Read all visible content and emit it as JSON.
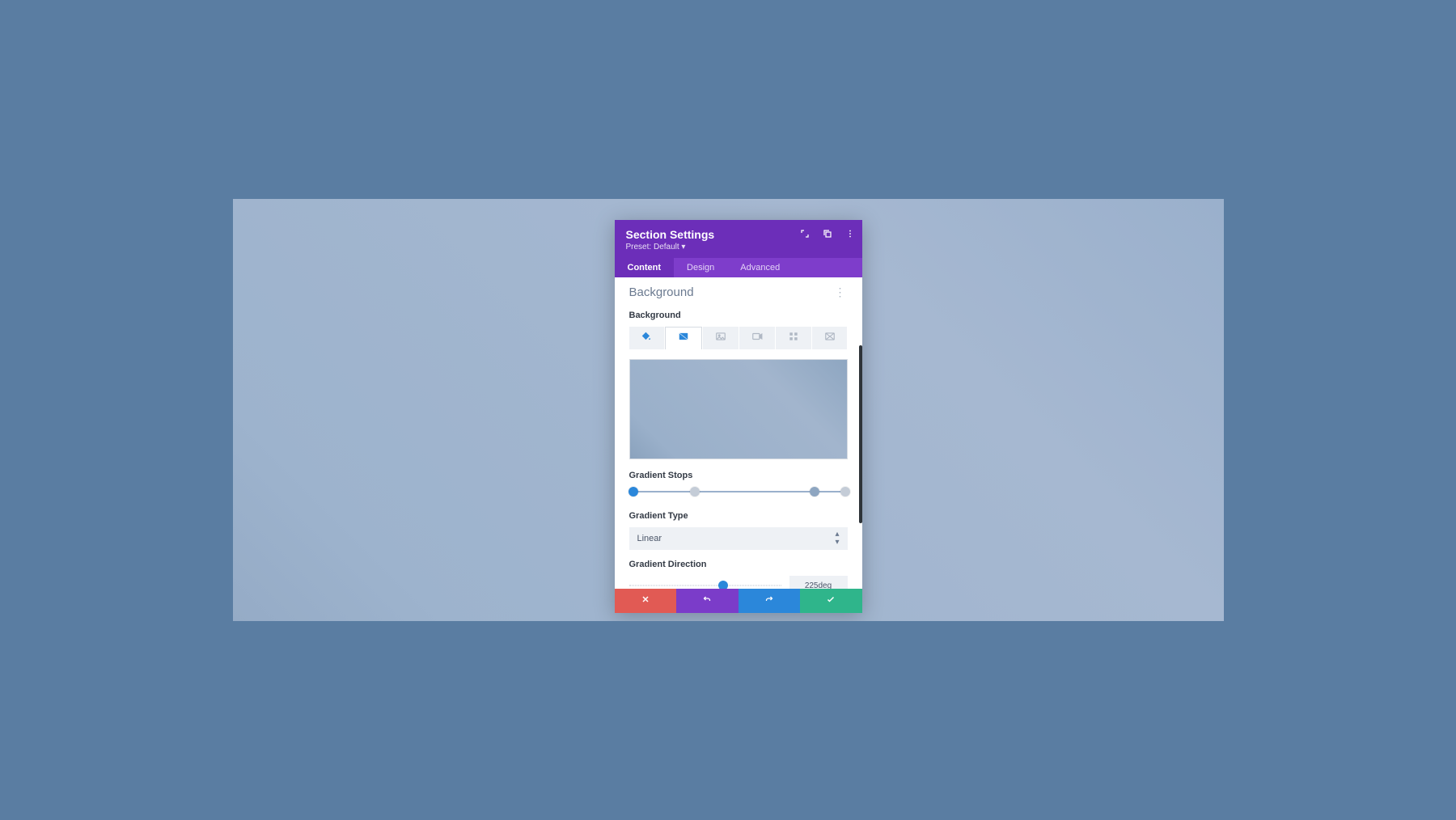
{
  "header": {
    "title": "Section Settings",
    "preset_prefix": "Preset: ",
    "preset_value": "Default ▾"
  },
  "tabs": [
    {
      "id": "content",
      "label": "Content",
      "active": true
    },
    {
      "id": "design",
      "label": "Design",
      "active": false
    },
    {
      "id": "advanced",
      "label": "Advanced",
      "active": false
    }
  ],
  "section": {
    "title": "Background"
  },
  "background": {
    "label": "Background",
    "type_tabs": [
      {
        "id": "color",
        "icon": "paint-bucket-icon",
        "active": false
      },
      {
        "id": "gradient",
        "icon": "gradient-icon",
        "active": true
      },
      {
        "id": "image",
        "icon": "image-icon",
        "active": false
      },
      {
        "id": "video",
        "icon": "video-icon",
        "active": false
      },
      {
        "id": "pattern",
        "icon": "pattern-icon",
        "active": false
      },
      {
        "id": "mask",
        "icon": "mask-icon",
        "active": false
      }
    ]
  },
  "gradient_stops": {
    "label": "Gradient Stops",
    "stops": [
      {
        "position": 0,
        "color": "#2b87da"
      },
      {
        "position": 30,
        "color": "#b9c2cf"
      },
      {
        "position": 85,
        "color": "#8ea6c1"
      },
      {
        "position": 100,
        "color": "#b9c2cf"
      }
    ]
  },
  "gradient_type": {
    "label": "Gradient Type",
    "value": "Linear"
  },
  "gradient_direction": {
    "label": "Gradient Direction",
    "value": "225deg",
    "slider_percent": 62
  },
  "footer": {
    "cancel": "cancel",
    "undo": "undo",
    "redo": "redo",
    "save": "save"
  }
}
